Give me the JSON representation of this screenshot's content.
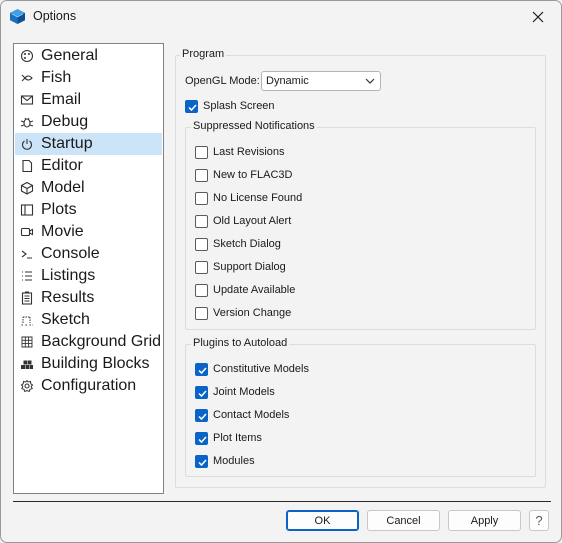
{
  "window": {
    "title": "Options",
    "close_icon": "close-icon",
    "app_icon": "cube-icon"
  },
  "sidebar": {
    "items": [
      {
        "label": "General",
        "icon": "palette-icon"
      },
      {
        "label": "Fish",
        "icon": "fish-icon"
      },
      {
        "label": "Email",
        "icon": "mail-icon"
      },
      {
        "label": "Debug",
        "icon": "bug-icon"
      },
      {
        "label": "Startup",
        "icon": "power-icon",
        "selected": true
      },
      {
        "label": "Editor",
        "icon": "document-icon"
      },
      {
        "label": "Model",
        "icon": "cube-icon"
      },
      {
        "label": "Plots",
        "icon": "plot-icon"
      },
      {
        "label": "Movie",
        "icon": "camera-icon"
      },
      {
        "label": "Console",
        "icon": "terminal-icon"
      },
      {
        "label": "Listings",
        "icon": "list-icon"
      },
      {
        "label": "Results",
        "icon": "results-icon"
      },
      {
        "label": "Sketch",
        "icon": "sketch-icon"
      },
      {
        "label": "Background Grid",
        "icon": "grid-icon"
      },
      {
        "label": "Building Blocks",
        "icon": "blocks-icon"
      },
      {
        "label": "Configuration",
        "icon": "gear-icon"
      }
    ]
  },
  "program": {
    "title": "Program",
    "opengl_label": "OpenGL Mode:",
    "opengl_value": "Dynamic",
    "splash_label": "Splash Screen",
    "splash_checked": true
  },
  "suppressed": {
    "title": "Suppressed Notifications",
    "items": [
      {
        "label": "Last Revisions",
        "checked": false
      },
      {
        "label": "New to FLAC3D",
        "checked": false
      },
      {
        "label": "No License Found",
        "checked": false
      },
      {
        "label": "Old Layout Alert",
        "checked": false
      },
      {
        "label": "Sketch Dialog",
        "checked": false
      },
      {
        "label": "Support Dialog",
        "checked": false
      },
      {
        "label": "Update Available",
        "checked": false
      },
      {
        "label": "Version Change",
        "checked": false
      }
    ]
  },
  "plugins": {
    "title": "Plugins to Autoload",
    "items": [
      {
        "label": "Constitutive Models",
        "checked": true
      },
      {
        "label": "Joint Models",
        "checked": true
      },
      {
        "label": "Contact Models",
        "checked": true
      },
      {
        "label": "Plot Items",
        "checked": true
      },
      {
        "label": "Modules",
        "checked": true
      }
    ]
  },
  "buttons": {
    "ok": "OK",
    "cancel": "Cancel",
    "apply": "Apply",
    "help": "?"
  }
}
